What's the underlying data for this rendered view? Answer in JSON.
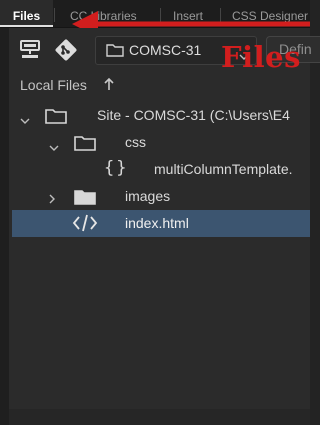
{
  "tabs": [
    {
      "label": "Files"
    },
    {
      "label": "CC Libraries"
    },
    {
      "label": "Insert"
    },
    {
      "label": "CSS Designer"
    }
  ],
  "toolbar": {
    "site_name": "COMSC-31",
    "define_label": "Defin"
  },
  "annotation": {
    "text": "Files",
    "color": "#d21e1e"
  },
  "panel": {
    "header": "Local Files"
  },
  "tree": [
    {
      "label": "Site - COMSC-31 (C:\\Users\\E4",
      "icon": "folder-icon"
    },
    {
      "label": "css",
      "icon": "folder-icon"
    },
    {
      "label": "multiColumnTemplate.",
      "icon": "css-braces-icon"
    },
    {
      "label": "images",
      "icon": "folder-icon"
    },
    {
      "label": "index.html",
      "icon": "code-tag-icon",
      "selected": true
    }
  ],
  "colors": {
    "selection": "#3c5570",
    "panel_bg": "#2b2b2b"
  }
}
